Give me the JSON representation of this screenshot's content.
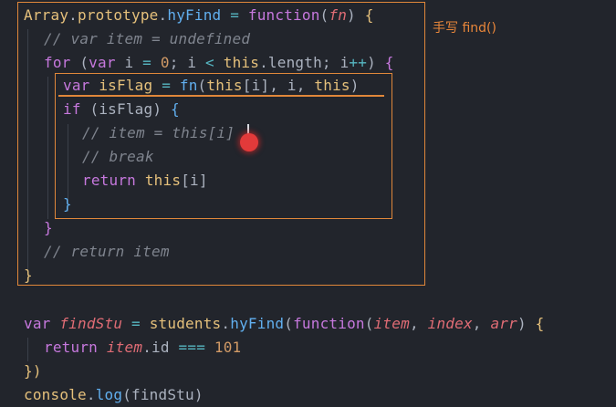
{
  "annotation": "手写 find()",
  "code": {
    "l1": {
      "a": "Array",
      "b": ".",
      "c": "prototype",
      "d": ".",
      "e": "hyFind",
      "f": " = ",
      "g": "function",
      "h": "(",
      "i": "fn",
      "j": ") ",
      "k": "{"
    },
    "l2": {
      "a": "// var item = undefined"
    },
    "l3": {
      "a": "for",
      "b": " (",
      "c": "var",
      "d": " i ",
      "e": "=",
      "f": " ",
      "g": "0",
      "h": "; i ",
      "i": "<",
      "j": " ",
      "k": "this",
      "l": ".length; i",
      "m": "++",
      "n": ") ",
      "o": "{"
    },
    "l4": {
      "a": "var",
      "b": " ",
      "c": "isFlag",
      "d": " ",
      "e": "=",
      "f": " ",
      "g": "fn",
      "h": "(",
      "i": "this",
      "j": "[i], i, ",
      "k": "this",
      "l": ")"
    },
    "l5": {
      "a": "if",
      "b": " (isFlag) ",
      "c": "{"
    },
    "l6": {
      "a": "// item = this[i]"
    },
    "l7": {
      "a": "// break"
    },
    "l8": {
      "a": "return",
      "b": " ",
      "c": "this",
      "d": "[i]"
    },
    "l9": {
      "a": "}"
    },
    "l10": {
      "a": "}"
    },
    "l11": {
      "a": "// return item"
    },
    "l12": {
      "a": "}"
    },
    "l13": {
      "a": "var",
      "b": " ",
      "c": "findStu",
      "d": " ",
      "e": "=",
      "f": " ",
      "g": "students",
      "h": ".",
      "i": "hyFind",
      "j": "(",
      "k": "function",
      "l": "(",
      "m": "item",
      "n": ", ",
      "o": "index",
      "p": ", ",
      "q": "arr",
      "r": ") ",
      "s": "{"
    },
    "l14": {
      "a": "return",
      "b": " ",
      "c": "item",
      "d": ".id ",
      "e": "===",
      "f": " ",
      "g": "101"
    },
    "l15": {
      "a": "})"
    },
    "l16": {
      "a": "console",
      "b": ".",
      "c": "log",
      "d": "(findStu)"
    }
  },
  "colors": {
    "annotation": "#e8863a",
    "highlight_box": "#e0873a",
    "cursor_dot": "#e23a3a",
    "background": "#22252c"
  }
}
